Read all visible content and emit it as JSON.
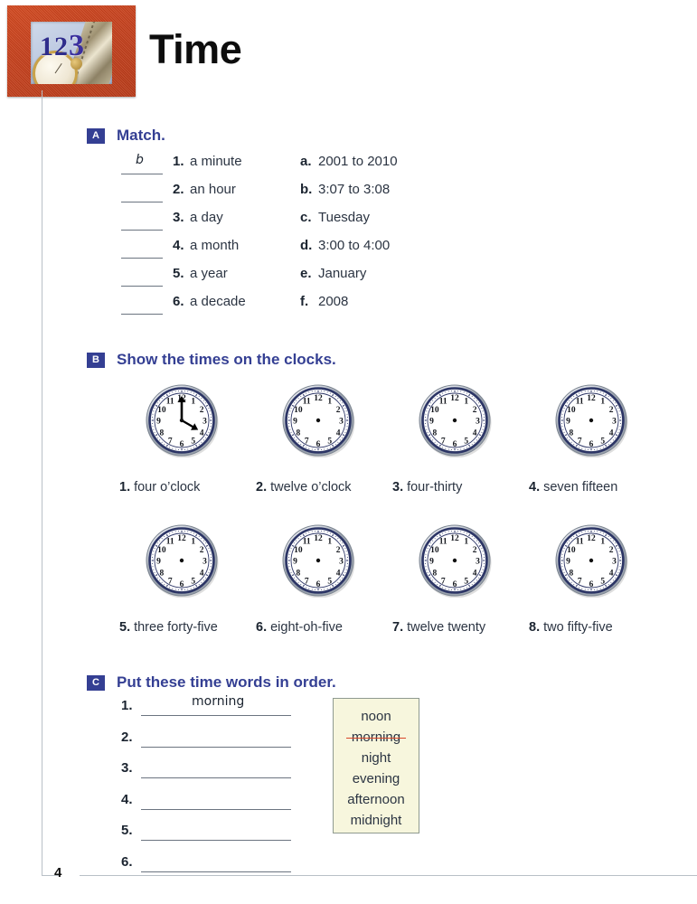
{
  "header": {
    "title": "Time",
    "thumbnail_digits_12": "12",
    "thumbnail_digit_3": "3"
  },
  "page": {
    "number": "4"
  },
  "sections": {
    "a": {
      "badge": "A",
      "title": "Match.",
      "left_items": [
        {
          "num": "1.",
          "text": "a minute",
          "answer": "b"
        },
        {
          "num": "2.",
          "text": "an hour",
          "answer": ""
        },
        {
          "num": "3.",
          "text": "a day",
          "answer": ""
        },
        {
          "num": "4.",
          "text": "a month",
          "answer": ""
        },
        {
          "num": "5.",
          "text": "a year",
          "answer": ""
        },
        {
          "num": "6.",
          "text": "a decade",
          "answer": ""
        }
      ],
      "right_items": [
        {
          "num": "a.",
          "text": "2001 to 2010"
        },
        {
          "num": "b.",
          "text": "3:07 to 3:08"
        },
        {
          "num": "c.",
          "text": "Tuesday"
        },
        {
          "num": "d.",
          "text": "3:00 to 4:00"
        },
        {
          "num": "e.",
          "text": "January"
        },
        {
          "num": "f.",
          "text": "2008"
        }
      ]
    },
    "b": {
      "badge": "B",
      "title": "Show the times on the clocks.",
      "clock_numerals": [
        "12",
        "1",
        "2",
        "3",
        "4",
        "5",
        "6",
        "7",
        "8",
        "9",
        "10",
        "11"
      ],
      "clocks": [
        {
          "num": "1.",
          "label": "four o’clock",
          "filled": true,
          "hour_deg": 120,
          "minute_deg": 0
        },
        {
          "num": "2.",
          "label": "twelve o’clock",
          "filled": false
        },
        {
          "num": "3.",
          "label": "four-thirty",
          "filled": false
        },
        {
          "num": "4.",
          "label": "seven fifteen",
          "filled": false
        },
        {
          "num": "5.",
          "label": "three forty-five",
          "filled": false
        },
        {
          "num": "6.",
          "label": "eight-oh-five",
          "filled": false
        },
        {
          "num": "7.",
          "label": "twelve twenty",
          "filled": false
        },
        {
          "num": "8.",
          "label": "two fifty-five",
          "filled": false
        }
      ]
    },
    "c": {
      "badge": "C",
      "title": "Put these time words in order.",
      "answer_lines": [
        {
          "num": "1.",
          "answer": "morning"
        },
        {
          "num": "2.",
          "answer": ""
        },
        {
          "num": "3.",
          "answer": ""
        },
        {
          "num": "4.",
          "answer": ""
        },
        {
          "num": "5.",
          "answer": ""
        },
        {
          "num": "6.",
          "answer": ""
        }
      ],
      "word_box": [
        {
          "word": "noon",
          "struck": false
        },
        {
          "word": "morning",
          "struck": true
        },
        {
          "word": "night",
          "struck": false
        },
        {
          "word": "evening",
          "struck": false
        },
        {
          "word": "afternoon",
          "struck": false
        },
        {
          "word": "midnight",
          "struck": false
        }
      ]
    }
  },
  "colors": {
    "accent_navy": "#343f93",
    "frame_orange": "#c6401c",
    "strike_red": "#d8452a",
    "wordbox_bg": "#f7f6dd",
    "rule_gray": "#b9c0c7"
  }
}
